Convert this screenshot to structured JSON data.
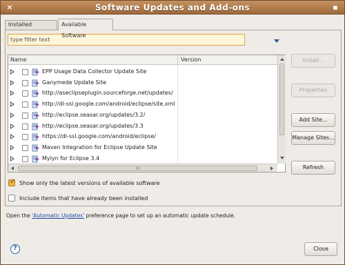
{
  "window": {
    "title": "Software Updates and Add-ons"
  },
  "tabs": [
    {
      "label": "Installed Software",
      "active": false
    },
    {
      "label": "Available Software",
      "active": true
    }
  ],
  "filter": {
    "value": "type filter text"
  },
  "table": {
    "columns": [
      "Name",
      "Version"
    ],
    "rows": [
      {
        "label": "EPP Usage Data Collector Update Site"
      },
      {
        "label": "Ganymede Update Site"
      },
      {
        "label": "http://aseclipseplugin.sourceforge.net/updates/"
      },
      {
        "label": "http://dl-ssl.google.com/android/eclipse/site.xml"
      },
      {
        "label": "http://eclipse.seasar.org/updates/3.2/"
      },
      {
        "label": "http://eclipse.seasar.org/updates/3.3"
      },
      {
        "label": "https://dl-ssl.google.com/android/eclipse/"
      },
      {
        "label": "Maven Integration for Eclipse Update Site"
      },
      {
        "label": "Mylyn for Eclipse 3.4"
      }
    ],
    "hscroll_grip": "III"
  },
  "buttons": {
    "install": "Install...",
    "properties": "Properties",
    "add_site": "Add Site...",
    "manage_sites": "Manage Sites...",
    "refresh": "Refresh",
    "close": "Close"
  },
  "options": {
    "latest_only": {
      "label": "Show only the latest versions of available software",
      "checked": true
    },
    "include_installed": {
      "label": "Include items that have already been installed",
      "checked": false
    }
  },
  "footer": {
    "prefix": "Open the ",
    "link": "'Automatic Updates'",
    "suffix": " preference page to set up an automatic update schedule."
  },
  "colors": {
    "titlebar": "#a97343",
    "filter_bg": "#fdf6d8",
    "link": "#1b4fa8"
  }
}
